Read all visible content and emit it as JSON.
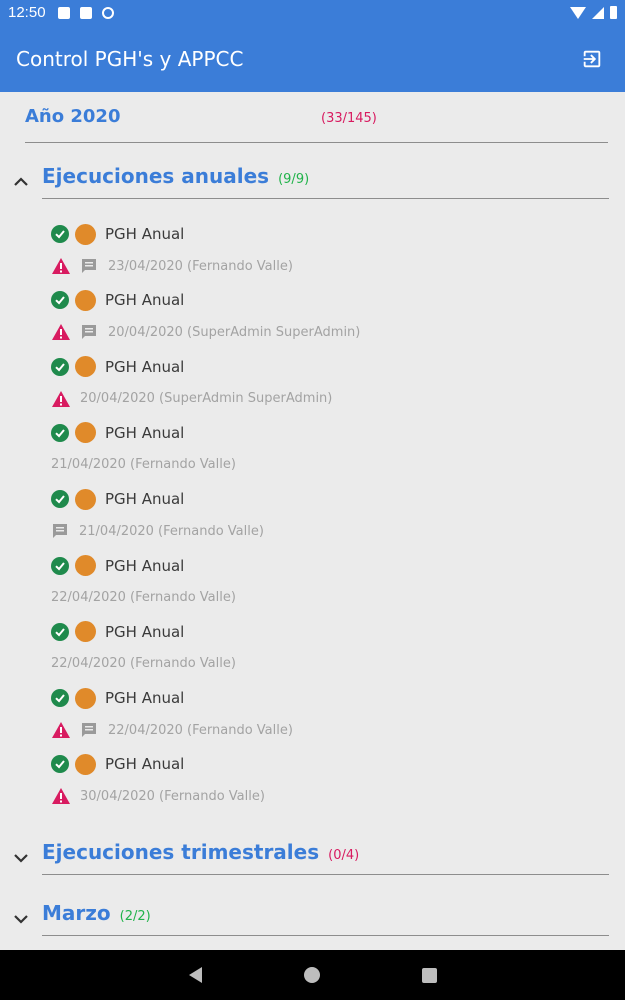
{
  "status_bar": {
    "time": "12:50"
  },
  "app_bar": {
    "title": "Control PGH's y APPCC"
  },
  "year": {
    "title": "Año 2020",
    "count": "(33/145)"
  },
  "sections": [
    {
      "title": "Ejecuciones anuales",
      "count": "(9/9)",
      "expanded": true
    },
    {
      "title": "Ejecuciones trimestrales",
      "count": "(0/4)",
      "expanded": false
    },
    {
      "title": "Marzo",
      "count": "(2/2)",
      "expanded": false
    }
  ],
  "items": [
    {
      "label": "PGH Anual",
      "detail": "23/04/2020 (Fernando Valle)",
      "warning": true,
      "comment": true
    },
    {
      "label": "PGH Anual",
      "detail": "20/04/2020 (SuperAdmin SuperAdmin)",
      "warning": true,
      "comment": true
    },
    {
      "label": "PGH Anual",
      "detail": "20/04/2020 (SuperAdmin SuperAdmin)",
      "warning": true,
      "comment": false
    },
    {
      "label": "PGH Anual",
      "detail": "21/04/2020 (Fernando Valle)",
      "warning": false,
      "comment": false
    },
    {
      "label": "PGH Anual",
      "detail": "21/04/2020 (Fernando Valle)",
      "warning": false,
      "comment": true
    },
    {
      "label": "PGH Anual",
      "detail": "22/04/2020 (Fernando Valle)",
      "warning": false,
      "comment": false
    },
    {
      "label": "PGH Anual",
      "detail": "22/04/2020 (Fernando Valle)",
      "warning": false,
      "comment": false
    },
    {
      "label": "PGH Anual",
      "detail": "22/04/2020 (Fernando Valle)",
      "warning": true,
      "comment": true
    },
    {
      "label": "PGH Anual",
      "detail": "30/04/2020 (Fernando Valle)",
      "warning": true,
      "comment": false
    }
  ],
  "colors": {
    "primary": "#3b7dd8",
    "ok": "#1f8a4c",
    "pending": "#e08a2a",
    "warning": "#d81b60",
    "complete_count": "#21b34a"
  }
}
